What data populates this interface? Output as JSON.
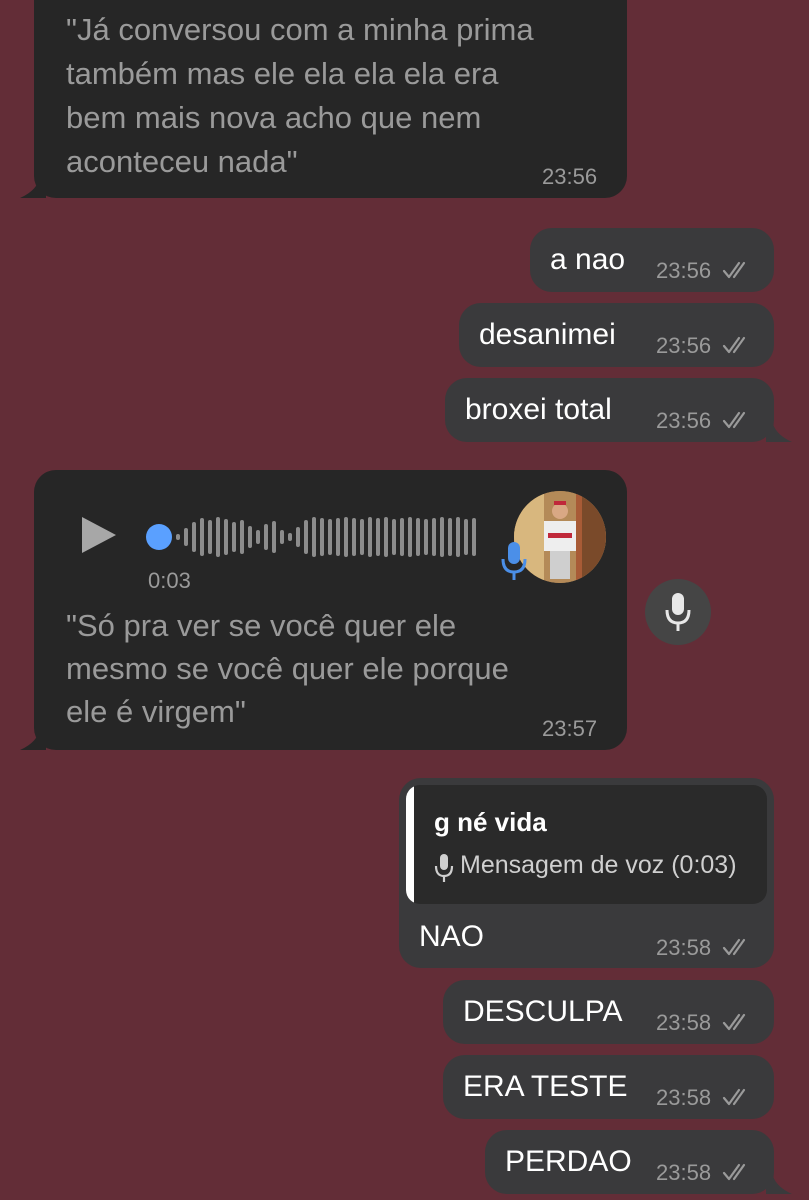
{
  "colors": {
    "background": "#632d37",
    "incoming_bubble": "#262626",
    "outgoing_bubble": "#3a3a3c",
    "accent": "#5aa0ff"
  },
  "messages": {
    "m1": {
      "line1": "\"Já conversou com a minha prima",
      "line2": "também mas ele ela ela ela era",
      "line3": "bem mais nova acho que nem",
      "line4": "aconteceu nada\"",
      "time": "23:56"
    },
    "m2": {
      "text": "a nao",
      "time": "23:56"
    },
    "m3": {
      "text": "desanimei",
      "time": "23:56"
    },
    "m4": {
      "text": "broxei total",
      "time": "23:56"
    },
    "voice": {
      "duration": "0:03",
      "line1": "\"Só pra ver se você quer ele",
      "line2": "mesmo se você quer ele porque",
      "line3": "ele é virgem\"",
      "time": "23:57",
      "play_icon": "play-icon",
      "transcribe_icon": "mic-icon"
    },
    "m6": {
      "reply_name": "g né vida",
      "reply_preview": "Mensagem de voz (0:03)",
      "text": "NAO",
      "time": "23:58"
    },
    "m7": {
      "text": "DESCULPA",
      "time": "23:58"
    },
    "m8": {
      "text": "ERA TESTE",
      "time": "23:58"
    },
    "m9": {
      "text": "PERDAO",
      "time": "23:58"
    }
  }
}
